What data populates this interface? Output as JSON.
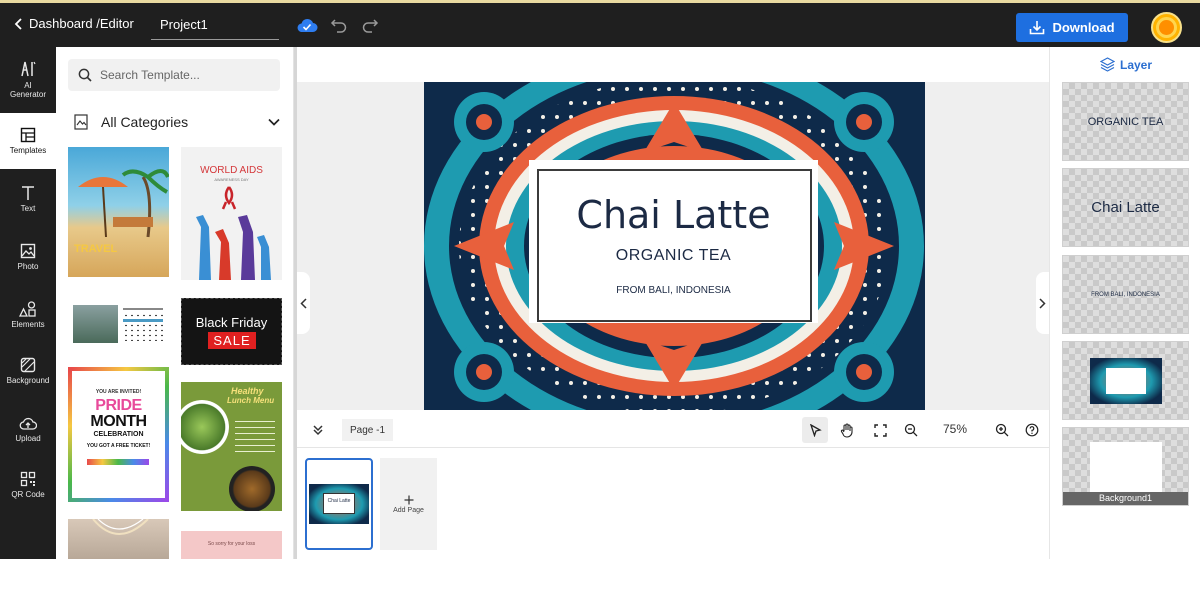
{
  "header": {
    "breadcrumb": "Dashboard /Editor",
    "project_name": "Project1",
    "download_label": "Download"
  },
  "left_nav": {
    "items": [
      {
        "label_line1": "AI",
        "label_line2": "Generator"
      },
      {
        "label_line1": "Templates",
        "label_line2": ""
      },
      {
        "label_line1": "Text",
        "label_line2": ""
      },
      {
        "label_line1": "Photo",
        "label_line2": ""
      },
      {
        "label_line1": "Elements",
        "label_line2": ""
      },
      {
        "label_line1": "Background",
        "label_line2": ""
      },
      {
        "label_line1": "Upload",
        "label_line2": ""
      },
      {
        "label_line1": "QR Code",
        "label_line2": ""
      }
    ],
    "active": "Templates"
  },
  "templates_panel": {
    "search_placeholder": "Search Template...",
    "category": "All Categories",
    "templates": [
      {
        "kind": "travel",
        "title": "TRAVEL"
      },
      {
        "kind": "world-aids",
        "title": "WORLD AIDS",
        "subtitle": "AWARENESS DAY"
      },
      {
        "kind": "calendar"
      },
      {
        "kind": "black-friday",
        "title": "Black Friday",
        "subtitle": "SALE"
      },
      {
        "kind": "pride",
        "line1": "YOU ARE INVITED!",
        "line2": "PRIDE",
        "line3": "MONTH",
        "line4": "CELEBRATION",
        "line5": "YOU GOT A FREE TICKET!"
      },
      {
        "kind": "lunch-menu",
        "title": "Healthy",
        "subtitle": "Lunch Menu"
      },
      {
        "kind": "jewelry"
      },
      {
        "kind": "sorry",
        "title": "So sorry for your loss"
      }
    ]
  },
  "canvas": {
    "design": {
      "title": "Chai Latte",
      "subtitle": "ORGANIC TEA",
      "origin": "FROM BALI, INDONESIA"
    }
  },
  "canvas_toolbar": {
    "page_label": "Page -1",
    "zoom": "75%"
  },
  "pages_strip": {
    "add_page_label": "Add Page"
  },
  "layers_panel": {
    "header": "Layer",
    "layers": [
      {
        "label": "ORGANIC TEA"
      },
      {
        "label": "Chai Latte"
      },
      {
        "label": "FROM BALI, INDONESIA"
      },
      {
        "label": ""
      },
      {
        "label": "Background1"
      }
    ]
  },
  "colors": {
    "topbar": "#1f1f1f",
    "accent": "#1e6fe0",
    "design_navy": "#0e2a4a",
    "design_teal": "#1e9bb0",
    "design_coral": "#e8603c"
  }
}
